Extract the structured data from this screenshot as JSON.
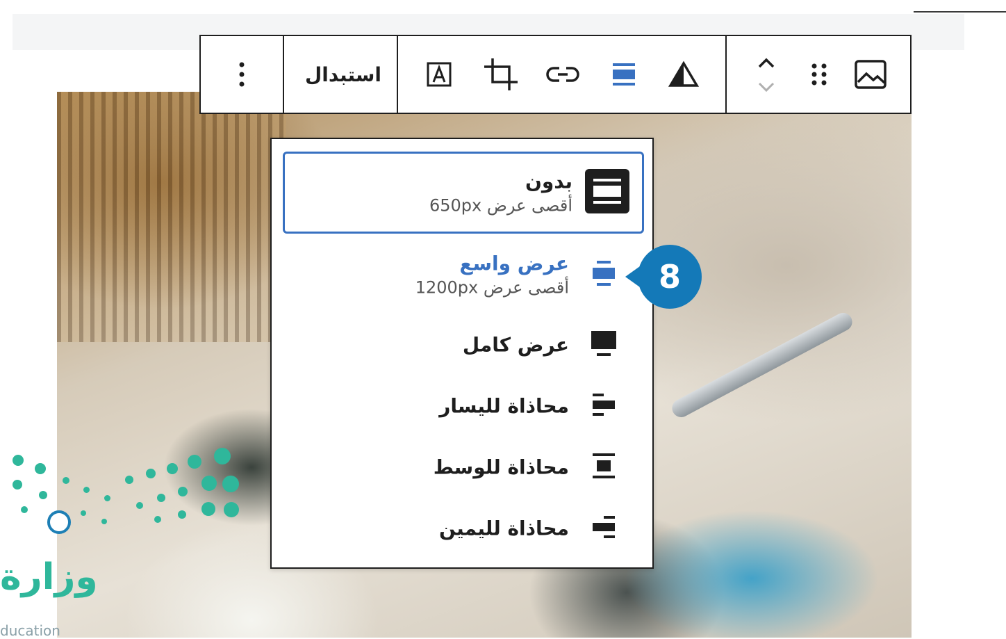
{
  "toolbar": {
    "replace_label": "استبدال",
    "icons": [
      "more-vertical-icon",
      "text-overlay-icon",
      "crop-icon",
      "link-icon",
      "align-wide-icon",
      "triangle-filter-icon",
      "move-up-down-icon",
      "drag-handle-icon",
      "image-icon"
    ]
  },
  "align_menu": {
    "items": [
      {
        "label": "بدون",
        "sub": "أقصى عرض 650px",
        "state": "selected"
      },
      {
        "label": "عرض واسع",
        "sub": "أقصى عرض 1200px",
        "state": "active"
      },
      {
        "label": "عرض كامل",
        "sub": ""
      },
      {
        "label": "محاذاة لليسار",
        "sub": ""
      },
      {
        "label": "محاذاة للوسط",
        "sub": ""
      },
      {
        "label": "محاذاة لليمين",
        "sub": ""
      }
    ]
  },
  "step_badge": "8",
  "logo": {
    "word": "وزارة",
    "sub": "ducation"
  },
  "colors": {
    "accent": "#3871c1",
    "badge": "#1479b8",
    "logo": "#2fb79b"
  }
}
